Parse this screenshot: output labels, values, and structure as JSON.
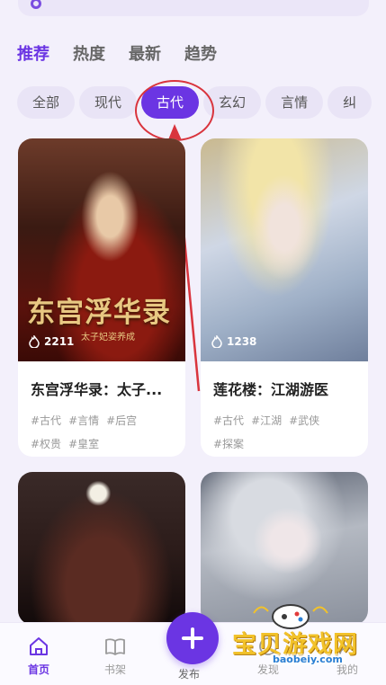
{
  "main_tabs": [
    "推荐",
    "热度",
    "最新",
    "趋势"
  ],
  "genre_chips": [
    "全部",
    "现代",
    "古代",
    "玄幻",
    "言情",
    "纠"
  ],
  "books": [
    {
      "cover_title": "东宫浮华录",
      "cover_subtitle": "太子妃姿养成",
      "heat": "2211",
      "title": "东宫浮华录：太子...",
      "tags": [
        "#古代",
        "#言情",
        "#后宫",
        "#权贵",
        "#皇室"
      ]
    },
    {
      "heat": "1238",
      "title": "莲花楼：江湖游医",
      "tags": [
        "#古代",
        "#江湖",
        "#武侠",
        "#探案"
      ]
    }
  ],
  "bottom_nav": {
    "home": "首页",
    "bookshelf": "书架",
    "publish": "发布",
    "discover": "发现",
    "mine": "我的"
  },
  "watermark": {
    "text": "宝贝游戏网",
    "url": "baobeiy.com"
  },
  "colors": {
    "accent": "#6b35e3",
    "annotation": "#d9343d"
  }
}
